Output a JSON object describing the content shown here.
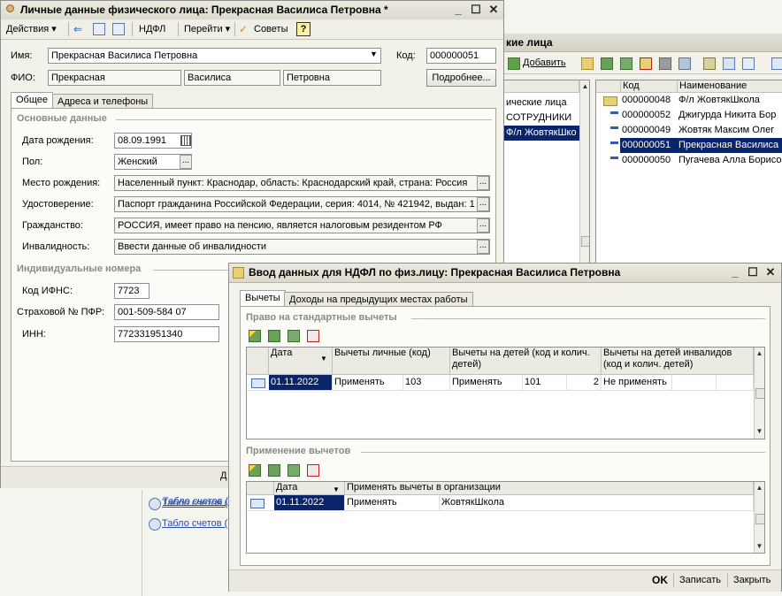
{
  "bg_list": {
    "title_fragment": "кие лица",
    "add_label": "Добавить",
    "left_col_header": "",
    "left_items": [
      "ические лица",
      "СОТРУДНИКИ",
      "Ф/л ЖовтякШко"
    ],
    "columns": [
      "Код",
      "Наименование"
    ],
    "rows": [
      {
        "code": "000000048",
        "name": "Ф/л ЖовтякШкола"
      },
      {
        "code": "000000052",
        "name": "Джигурда Никита Бор"
      },
      {
        "code": "000000049",
        "name": "Жовтяк Максим Олег"
      },
      {
        "code": "000000051",
        "name": "Прекрасная Василиса"
      },
      {
        "code": "000000050",
        "name": "Пугачева Алла Борисо"
      }
    ],
    "links": [
      "Табло счетов (",
      "Табло счетов ("
    ]
  },
  "personal": {
    "title": "Личные данные физического лица: Прекрасная Василиса Петровна *",
    "toolbar": {
      "actions": "Действия",
      "ndfl": "НДФЛ",
      "goto": "Перейти",
      "tips": "Советы"
    },
    "name_label": "Имя:",
    "name_value": "Прекрасная Василиса Петровна",
    "code_label": "Код:",
    "code_value": "000000051",
    "fio_label": "ФИО:",
    "fio": [
      "Прекрасная",
      "Василиса",
      "Петровна"
    ],
    "details_button": "Подробнее...",
    "tabs": [
      "Общее",
      "Адреса и телефоны"
    ],
    "section_main": "Основные данные",
    "birth_label": "Дата рождения:",
    "birth_value": "08.09.1991",
    "sex_label": "Пол:",
    "sex_value": "Женский",
    "birthplace_label": "Место рождения:",
    "birthplace_value": "Населенный пункт: Краснодар, область: Краснодарский край, страна: Россия",
    "id_label": "Удостоверение:",
    "id_value": "Паспорт гражданина Российской Федерации, серия: 4014, № 421942, выдан: 1",
    "citizenship_label": "Гражданство:",
    "citizenship_value": "РОССИЯ, имеет право на пенсию, является налоговым резидентом РФ",
    "disability_label": "Инвалидность:",
    "disability_value": "Ввести данные об инвалидности",
    "section_ids": "Индивидуальные номера",
    "ifns_label": "Код ИФНС:",
    "ifns_value": "7723",
    "pfr_label": "Страховой № ПФР:",
    "pfr_value": "001-509-584 07",
    "inn_label": "ИНН:",
    "inn_value": "772331951340",
    "bottom_fragment": "Д"
  },
  "ndfl": {
    "title": "Ввод данных для НДФЛ по физ.лицу: Прекрасная Василиса Петровна",
    "tabs": [
      "Вычеты",
      "Доходы на предыдущих местах работы"
    ],
    "section_rights": "Право на стандартные вычеты",
    "grid1_headers": [
      "Дата",
      "Вычеты личные (код)",
      "Вычеты на детей (код и колич. детей)",
      "Вычеты на детей инвалидов (код и колич. детей)"
    ],
    "grid1_row": {
      "date": "01.11.2022",
      "personal_apply": "Применять",
      "personal_code": "103",
      "kids_apply": "Применять",
      "kids_code": "101",
      "kids_count": "2",
      "disabled_apply": "Не применять"
    },
    "section_apply": "Применение вычетов",
    "grid2_headers": [
      "Дата",
      "Применять вычеты в организации"
    ],
    "grid2_row": {
      "date": "01.11.2022",
      "apply": "Применять",
      "org": "ЖовтякШкола"
    },
    "buttons": {
      "ok": "OK",
      "save": "Записать",
      "close": "Закрыть"
    }
  },
  "colors": {
    "selection": "#0a246a",
    "section_text": "#8a8a8a",
    "link": "#2a4aa8"
  }
}
